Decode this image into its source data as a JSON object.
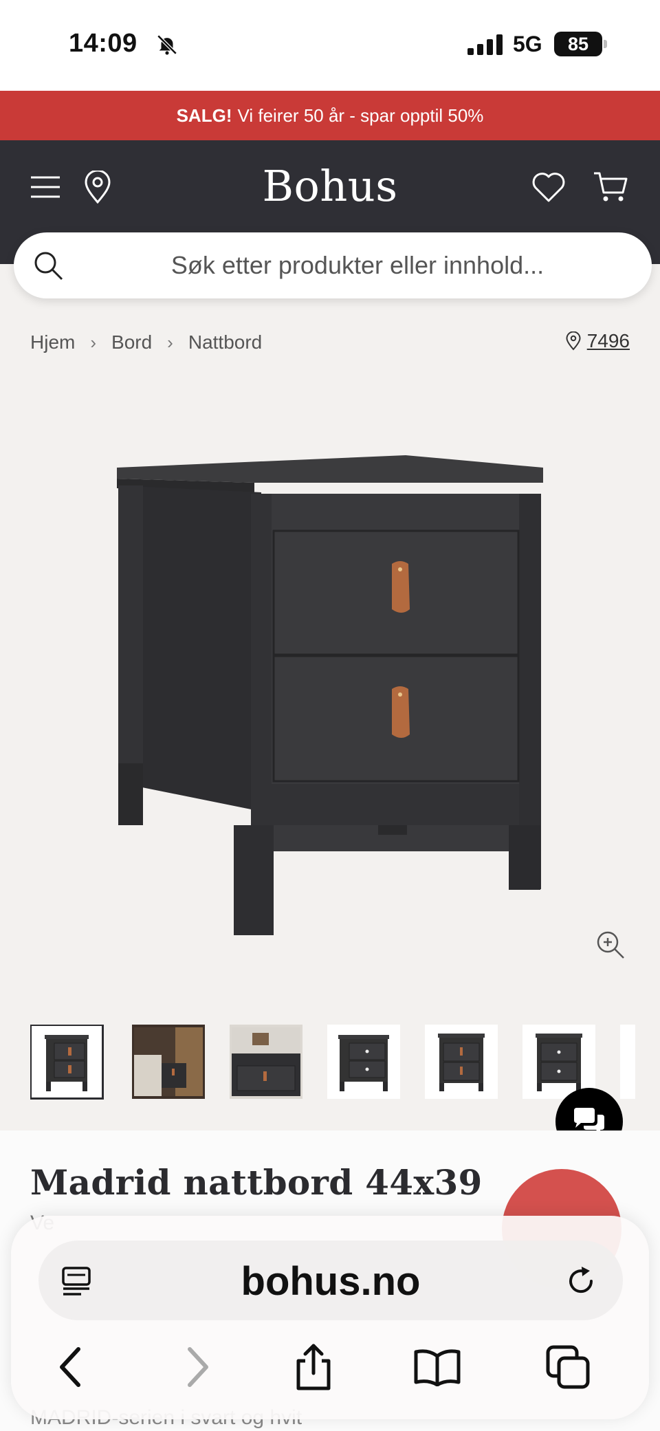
{
  "status_bar": {
    "time": "14:09",
    "network": "5G",
    "battery": "85"
  },
  "promo": {
    "bold": "SALG!",
    "text": "Vi feirer 50 år - spar opptil 50%",
    "color": "#c93a37"
  },
  "header": {
    "logo": "Bohus",
    "background": "#2f2f35",
    "icons": [
      "menu-icon",
      "location-pin-icon",
      "heart-icon",
      "cart-icon"
    ]
  },
  "search": {
    "placeholder": "Søk etter produkter eller innhold..."
  },
  "breadcrumb": {
    "items": [
      "Hjem",
      "Bord",
      "Nattbord"
    ]
  },
  "store": {
    "value": "7496"
  },
  "thumbnails": {
    "count": 7,
    "selected_index": 0
  },
  "product": {
    "title": "Madrid nattbord 44x39",
    "subtitle_peek": "Ve",
    "description_peek": "MADRID-serien i svart og hvit"
  },
  "browser": {
    "url": "bohus.no"
  }
}
